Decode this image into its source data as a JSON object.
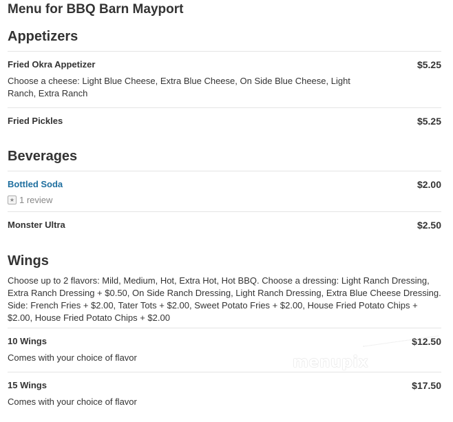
{
  "page": {
    "title": "Menu for BBQ Barn Mayport"
  },
  "sections": [
    {
      "title": "Appetizers",
      "items": [
        {
          "name": "Fried Okra Appetizer",
          "price": "$5.25",
          "description": "Choose a cheese: Light Blue Cheese, Extra Blue Cheese, On Side Blue Cheese, Light Ranch, Extra Ranch"
        },
        {
          "name": "Fried Pickles",
          "price": "$5.25"
        }
      ]
    },
    {
      "title": "Beverages",
      "items": [
        {
          "name": "Bottled Soda",
          "price": "$2.00",
          "review_text": "1 review",
          "review_icon": "review-star-icon"
        },
        {
          "name": "Monster Ultra",
          "price": "$2.50"
        }
      ]
    },
    {
      "title": "Wings",
      "description": "Choose up to 2 flavors: Mild, Medium, Hot, Extra Hot, Hot BBQ. Choose a dressing: Light Ranch Dressing, Extra Ranch Dressing + $0.50, On Side Ranch Dressing, Light Ranch Dressing, Extra Blue Cheese Dressing. Side: French Fries + $2.00, Tater Tots + $2.00, Sweet Potato Fries + $2.00, House Fried Potato Chips + $2.00, House Fried Potato Chips + $2.00",
      "items": [
        {
          "name": "10 Wings",
          "price": "$12.50",
          "description": "Comes with your choice of flavor"
        },
        {
          "name": "15 Wings",
          "price": "$17.50",
          "description": "Comes with your choice of flavor"
        }
      ]
    }
  ],
  "watermark": {
    "text": "menupix"
  },
  "colors": {
    "text": "#333333",
    "link": "#1f6f9f",
    "divider": "#e4e4e4",
    "muted": "#888888"
  }
}
